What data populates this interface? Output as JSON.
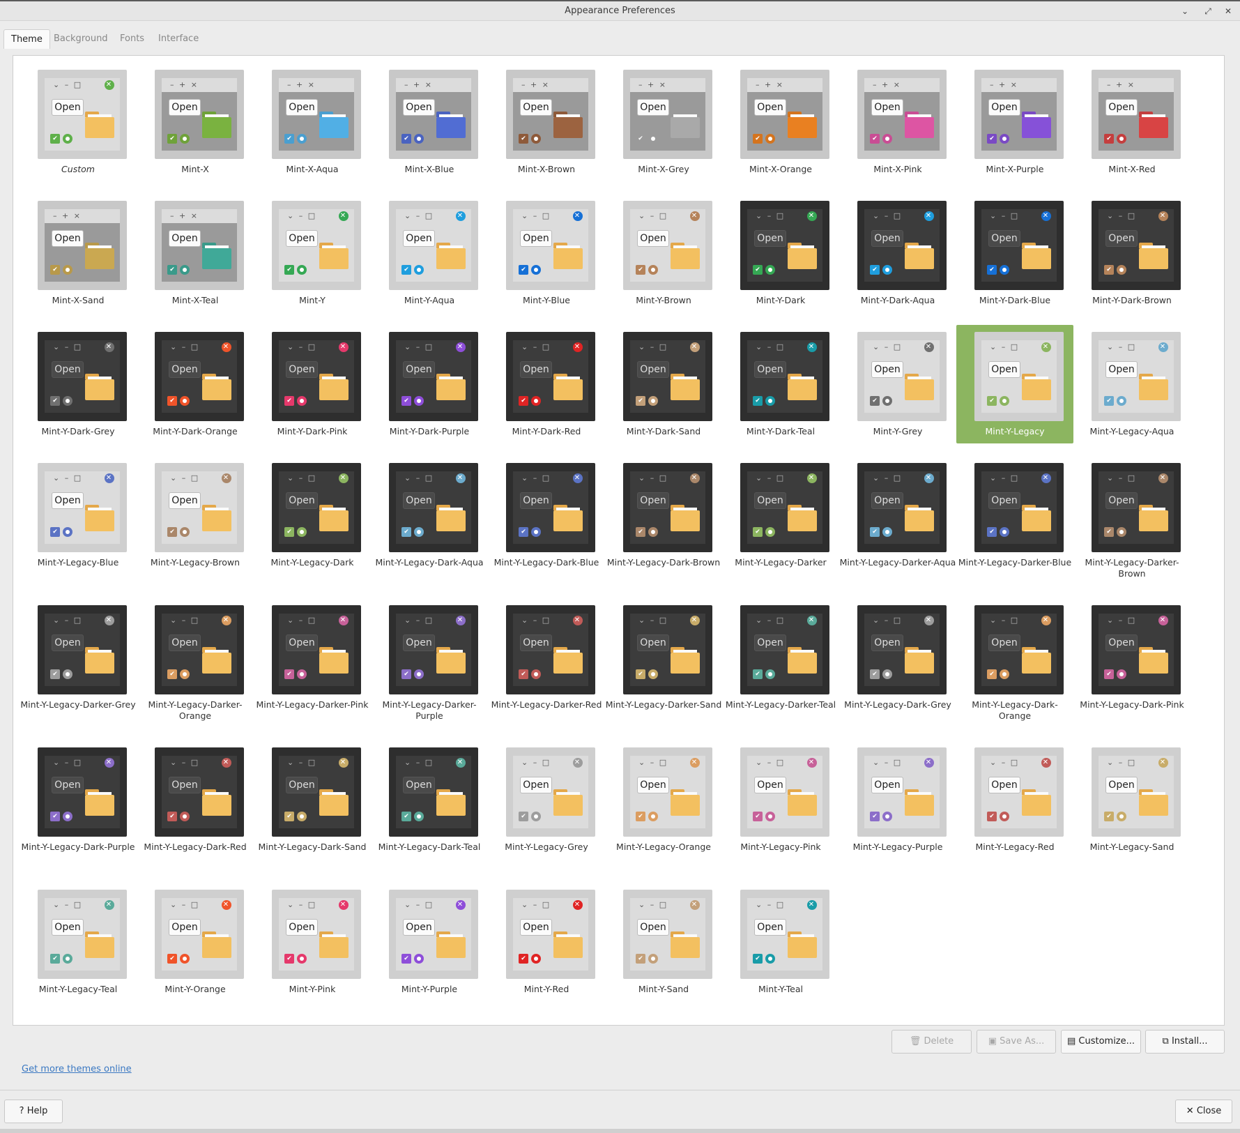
{
  "window": {
    "title": "Appearance Preferences",
    "controls": [
      "minimize-icon",
      "maximize-icon",
      "close-icon"
    ]
  },
  "tabs": [
    {
      "label": "Theme",
      "active": true
    },
    {
      "label": "Background",
      "active": false
    },
    {
      "label": "Fonts",
      "active": false
    },
    {
      "label": "Interface",
      "active": false
    }
  ],
  "themes": [
    {
      "name": "Custom",
      "style": "light",
      "accent": "#5fb04a",
      "italic": true
    },
    {
      "name": "Mint-X",
      "style": "x",
      "accent": "#6fa23a"
    },
    {
      "name": "Mint-X-Aqua",
      "style": "x",
      "accent": "#4a9fd0"
    },
    {
      "name": "Mint-X-Blue",
      "style": "x",
      "accent": "#4a63c0"
    },
    {
      "name": "Mint-X-Brown",
      "style": "x",
      "accent": "#8e5a3a"
    },
    {
      "name": "Mint-X-Grey",
      "style": "x",
      "accent": "#9a9a9a"
    },
    {
      "name": "Mint-X-Orange",
      "style": "x",
      "accent": "#d4741e"
    },
    {
      "name": "Mint-X-Pink",
      "style": "x",
      "accent": "#c94d94"
    },
    {
      "name": "Mint-X-Purple",
      "style": "x",
      "accent": "#7a4ac4"
    },
    {
      "name": "Mint-X-Red",
      "style": "x",
      "accent": "#c43e3e"
    },
    {
      "name": "Mint-X-Sand",
      "style": "x",
      "accent": "#b8994a"
    },
    {
      "name": "Mint-X-Teal",
      "style": "x",
      "accent": "#3a9a8a"
    },
    {
      "name": "Mint-Y",
      "style": "light",
      "accent": "#35a854"
    },
    {
      "name": "Mint-Y-Aqua",
      "style": "light",
      "accent": "#1f9ede"
    },
    {
      "name": "Mint-Y-Blue",
      "style": "light",
      "accent": "#1670d6"
    },
    {
      "name": "Mint-Y-Brown",
      "style": "light",
      "accent": "#b5835a"
    },
    {
      "name": "Mint-Y-Dark",
      "style": "dark",
      "accent": "#35a854"
    },
    {
      "name": "Mint-Y-Dark-Aqua",
      "style": "dark",
      "accent": "#1f9ede"
    },
    {
      "name": "Mint-Y-Dark-Blue",
      "style": "dark",
      "accent": "#1670d6"
    },
    {
      "name": "Mint-Y-Dark-Brown",
      "style": "dark",
      "accent": "#b5835a"
    },
    {
      "name": "Mint-Y-Dark-Grey",
      "style": "dark",
      "accent": "#707070"
    },
    {
      "name": "Mint-Y-Dark-Orange",
      "style": "dark",
      "accent": "#f0542a"
    },
    {
      "name": "Mint-Y-Dark-Pink",
      "style": "dark",
      "accent": "#e5396b"
    },
    {
      "name": "Mint-Y-Dark-Purple",
      "style": "dark",
      "accent": "#8e4ed9"
    },
    {
      "name": "Mint-Y-Dark-Red",
      "style": "dark",
      "accent": "#e02424"
    },
    {
      "name": "Mint-Y-Dark-Sand",
      "style": "dark",
      "accent": "#c3a07a"
    },
    {
      "name": "Mint-Y-Dark-Teal",
      "style": "dark",
      "accent": "#199ca8"
    },
    {
      "name": "Mint-Y-Grey",
      "style": "light",
      "accent": "#707070"
    },
    {
      "name": "Mint-Y-Legacy",
      "style": "light",
      "accent": "#8cb560",
      "selected": true
    },
    {
      "name": "Mint-Y-Legacy-Aqua",
      "style": "light",
      "accent": "#6cabcd"
    },
    {
      "name": "Mint-Y-Legacy-Blue",
      "style": "light",
      "accent": "#5b73c4"
    },
    {
      "name": "Mint-Y-Legacy-Brown",
      "style": "light",
      "accent": "#aa876a"
    },
    {
      "name": "Mint-Y-Legacy-Dark",
      "style": "dark",
      "accent": "#8cb560"
    },
    {
      "name": "Mint-Y-Legacy-Dark-Aqua",
      "style": "dark",
      "accent": "#6cabcd"
    },
    {
      "name": "Mint-Y-Legacy-Dark-Blue",
      "style": "dark",
      "accent": "#5b73c4"
    },
    {
      "name": "Mint-Y-Legacy-Dark-Brown",
      "style": "dark",
      "accent": "#aa876a"
    },
    {
      "name": "Mint-Y-Legacy-Darker",
      "style": "dark",
      "accent": "#8cb560"
    },
    {
      "name": "Mint-Y-Legacy-Darker-Aqua",
      "style": "dark",
      "accent": "#6cabcd"
    },
    {
      "name": "Mint-Y-Legacy-Darker-Blue",
      "style": "dark",
      "accent": "#5b73c4"
    },
    {
      "name": "Mint-Y-Legacy-Darker-Brown",
      "style": "dark",
      "accent": "#aa876a"
    },
    {
      "name": "Mint-Y-Legacy-Darker-Grey",
      "style": "dark",
      "accent": "#9d9d9d"
    },
    {
      "name": "Mint-Y-Legacy-Darker-Orange",
      "style": "dark",
      "accent": "#db9d61"
    },
    {
      "name": "Mint-Y-Legacy-Darker-Pink",
      "style": "dark",
      "accent": "#c76199"
    },
    {
      "name": "Mint-Y-Legacy-Darker-Purple",
      "style": "dark",
      "accent": "#8c6ec9"
    },
    {
      "name": "Mint-Y-Legacy-Darker-Red",
      "style": "dark",
      "accent": "#c15b58"
    },
    {
      "name": "Mint-Y-Legacy-Darker-Sand",
      "style": "dark",
      "accent": "#c8ac69"
    },
    {
      "name": "Mint-Y-Legacy-Darker-Teal",
      "style": "dark",
      "accent": "#5aaa9a"
    },
    {
      "name": "Mint-Y-Legacy-Dark-Grey",
      "style": "dark",
      "accent": "#9d9d9d"
    },
    {
      "name": "Mint-Y-Legacy-Dark-Orange",
      "style": "dark",
      "accent": "#db9d61"
    },
    {
      "name": "Mint-Y-Legacy-Dark-Pink",
      "style": "dark",
      "accent": "#c76199"
    },
    {
      "name": "Mint-Y-Legacy-Dark-Purple",
      "style": "dark",
      "accent": "#8c6ec9"
    },
    {
      "name": "Mint-Y-Legacy-Dark-Red",
      "style": "dark",
      "accent": "#c15b58"
    },
    {
      "name": "Mint-Y-Legacy-Dark-Sand",
      "style": "dark",
      "accent": "#c8ac69"
    },
    {
      "name": "Mint-Y-Legacy-Dark-Teal",
      "style": "dark",
      "accent": "#5aaa9a"
    },
    {
      "name": "Mint-Y-Legacy-Grey",
      "style": "light",
      "accent": "#9d9d9d"
    },
    {
      "name": "Mint-Y-Legacy-Orange",
      "style": "light",
      "accent": "#db9d61"
    },
    {
      "name": "Mint-Y-Legacy-Pink",
      "style": "light",
      "accent": "#c76199"
    },
    {
      "name": "Mint-Y-Legacy-Purple",
      "style": "light",
      "accent": "#8c6ec9"
    },
    {
      "name": "Mint-Y-Legacy-Red",
      "style": "light",
      "accent": "#c15b58"
    },
    {
      "name": "Mint-Y-Legacy-Sand",
      "style": "light",
      "accent": "#c8ac69"
    },
    {
      "name": "Mint-Y-Legacy-Teal",
      "style": "light",
      "accent": "#5aaa9a"
    },
    {
      "name": "Mint-Y-Orange",
      "style": "light",
      "accent": "#f0542a"
    },
    {
      "name": "Mint-Y-Pink",
      "style": "light",
      "accent": "#e5396b"
    },
    {
      "name": "Mint-Y-Purple",
      "style": "light",
      "accent": "#8e4ed9"
    },
    {
      "name": "Mint-Y-Red",
      "style": "light",
      "accent": "#e02424"
    },
    {
      "name": "Mint-Y-Sand",
      "style": "light",
      "accent": "#c3a07a"
    },
    {
      "name": "Mint-Y-Teal",
      "style": "light",
      "accent": "#199ca8"
    }
  ],
  "thumbnail": {
    "open_label": "Open",
    "titlebar_light": "⌄ – □",
    "titlebar_x": "– + ×",
    "close_glyph": "✕",
    "check_glyph": "✔"
  },
  "actions": {
    "delete": "Delete",
    "save_as": "Save As...",
    "customize": "Customize...",
    "install": "Install..."
  },
  "link": "Get more themes online",
  "footer": {
    "help": "Help",
    "close": "Close"
  },
  "colors": {
    "selection": "#8cb560",
    "link": "#3a78c2",
    "folder": "#f3c060"
  }
}
